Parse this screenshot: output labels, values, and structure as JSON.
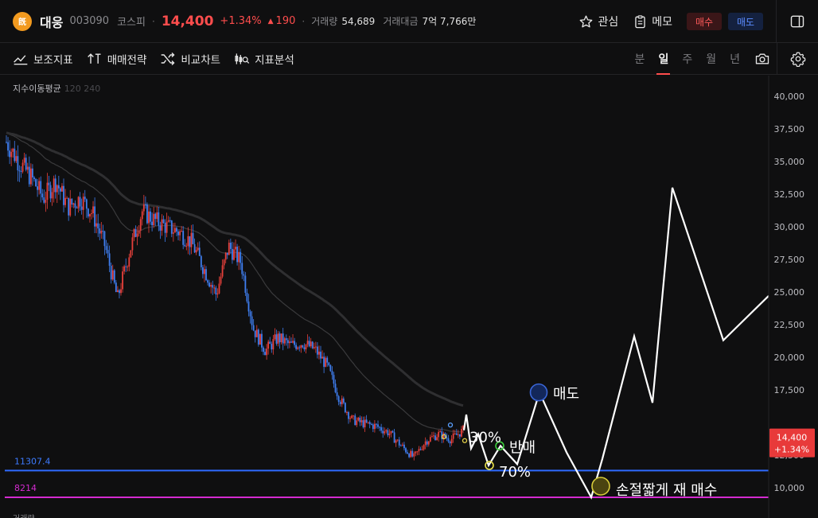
{
  "header": {
    "logo_text": "旣",
    "name": "대웅",
    "code": "003090",
    "market": "코스피",
    "price": "14,400",
    "change_rate": "+1.34%",
    "change_arrow": "▲",
    "change_amount": "190",
    "volume_label": "거래량",
    "volume_value": "54,689",
    "amount_label": "거래대금",
    "amount_value": "7억 7,766만",
    "watch_label": "관심",
    "memo_label": "메모",
    "buy_label": "매수",
    "sell_label": "매도"
  },
  "toolbar": {
    "tools": [
      "보조지표",
      "매매전략",
      "비교차트",
      "지표분석"
    ],
    "periods": [
      "분",
      "일",
      "주",
      "월",
      "년"
    ],
    "active_period": "일"
  },
  "chart": {
    "indicator_name": "지수이동평균",
    "indicator_periods": "120 240",
    "bottom_label": "거래량",
    "y_ticks": [
      "40,000",
      "37,500",
      "35,000",
      "32,500",
      "30,000",
      "27,500",
      "25,000",
      "22,500",
      "20,000",
      "17,500",
      "12,500",
      "10,000"
    ],
    "current_price_tag": "14,400",
    "current_rate_tag": "+1.34%",
    "support_line_label": "11307.4",
    "bottom_line_label": "8214",
    "annotations": {
      "pct30": "30%",
      "half_sell": "반매",
      "pct70": "70%",
      "sell": "매도",
      "rebuy": "손절짧게 재 매수"
    },
    "colors": {
      "up": "#e8403b",
      "down": "#3f7ef0",
      "support": "#2f6bff",
      "bottom": "#d42bd0",
      "price_tag": "#e83a3a"
    }
  },
  "chart_data": {
    "type": "candlestick",
    "ylim": [
      8000,
      40800
    ],
    "y_scale_ticks": [
      40000,
      37500,
      35000,
      32500,
      30000,
      27500,
      25000,
      22500,
      20000,
      17500,
      12500,
      10000
    ],
    "current_price": 14400,
    "horizontal_lines": [
      11307.4,
      8214
    ],
    "close_path": [
      36500,
      35000,
      33800,
      32200,
      33500,
      31500,
      32200,
      31000,
      28500,
      24500,
      28200,
      31200,
      30500,
      30000,
      29600,
      28800,
      26800,
      24800,
      28500,
      27300,
      22200,
      20500,
      21500,
      20900,
      21100,
      20600,
      19300,
      16800,
      15200,
      14900,
      14700,
      14200,
      13200,
      12300,
      13600,
      14100,
      13700,
      14400
    ],
    "projection": {
      "points": [
        14400,
        15600,
        13000,
        14100,
        11700,
        13200,
        11800,
        17300,
        12700,
        8600,
        12200,
        21600,
        16500,
        33000,
        21300,
        24700
      ],
      "marks": [
        {
          "label": "30%",
          "value": 13000
        },
        {
          "label": "반매",
          "value": 13200
        },
        {
          "label": "70%",
          "value": 11800
        },
        {
          "label": "매도",
          "value": 17300
        },
        {
          "label": "손절짧게 재 매수",
          "value": 8600
        }
      ]
    }
  }
}
